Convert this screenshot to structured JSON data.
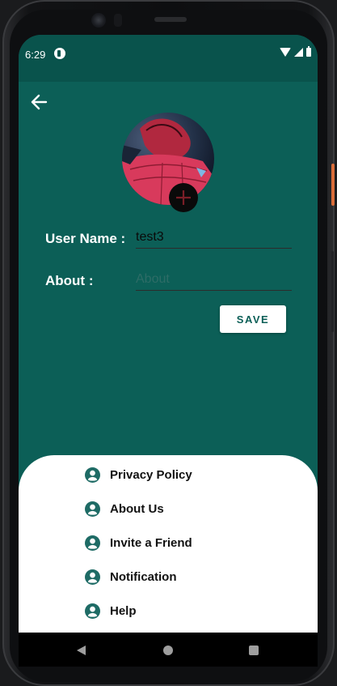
{
  "status_bar": {
    "time": "6:29",
    "icons": [
      "app-notification-icon",
      "wifi-icon",
      "signal-icon",
      "battery-icon"
    ]
  },
  "header": {
    "back_icon": "arrow-left-icon"
  },
  "profile": {
    "avatar_icon": "profile-photo",
    "add_photo_icon": "plus-icon",
    "username_label": "User Name :",
    "username_value": "test3",
    "about_label": "About :",
    "about_placeholder": "About",
    "save_label": "SAVE"
  },
  "menu": {
    "items": [
      {
        "label": "Privacy Policy",
        "icon": "account-circle-icon"
      },
      {
        "label": "About Us",
        "icon": "account-circle-icon"
      },
      {
        "label": "Invite a Friend",
        "icon": "account-circle-icon"
      },
      {
        "label": "Notification",
        "icon": "account-circle-icon"
      },
      {
        "label": "Help",
        "icon": "account-circle-icon"
      }
    ]
  },
  "navigation": {
    "icons": [
      "nav-back-icon",
      "nav-home-icon",
      "nav-recents-icon"
    ]
  },
  "colors": {
    "primary": "#0c5f57",
    "status_bar": "#09534c",
    "sheet": "#ffffff",
    "menu_icon": "#1e6b65"
  }
}
